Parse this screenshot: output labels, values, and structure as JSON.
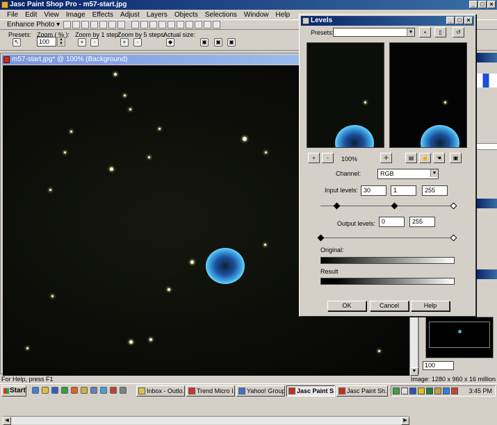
{
  "app": {
    "title": "Jasc Paint Shop Pro - m57-start.jpg",
    "menu": [
      "File",
      "Edit",
      "View",
      "Image",
      "Effects",
      "Adjust",
      "Layers",
      "Objects",
      "Selections",
      "Window",
      "Help"
    ]
  },
  "toolbar1": {
    "enhance_label": "Enhance Photo"
  },
  "toolbar2": {
    "presets_label": "Presets:",
    "zoom_label": "Zoom ( % ):",
    "zoom_value": "100",
    "zoom_step1_label": "Zoom by 1 step:",
    "zoom_step5_label": "Zoom by 5 steps:",
    "actual_size_label": "Actual size:"
  },
  "image_window": {
    "title": "m57-start.jpg* @ 100% (Background)"
  },
  "levels": {
    "title": "Levels",
    "presets_label": "Presets:",
    "zoom_pct": "100%",
    "channel_label": "Channel:",
    "channel_value": "RGB",
    "input_label": "Input levels:",
    "input_values": [
      "30",
      "1",
      "255"
    ],
    "output_label": "Output levels:",
    "output_values": [
      "0",
      "255"
    ],
    "original_label": "Original:",
    "result_label": "Result",
    "ok": "OK",
    "cancel": "Cancel",
    "help": "Help"
  },
  "overview": {
    "zoom_value": "100"
  },
  "status": {
    "help_text": "For Help, press F1",
    "image_info": "Image: 1280 x 960 x 16 million"
  },
  "taskbar": {
    "start": "Start",
    "tasks": [
      "Inbox - Outlo...",
      "Trend Micro I...",
      "Yahoo! Group...",
      "Jasc Paint S...",
      "Jasc Paint Sh..."
    ],
    "clock": "3:45 PM"
  }
}
